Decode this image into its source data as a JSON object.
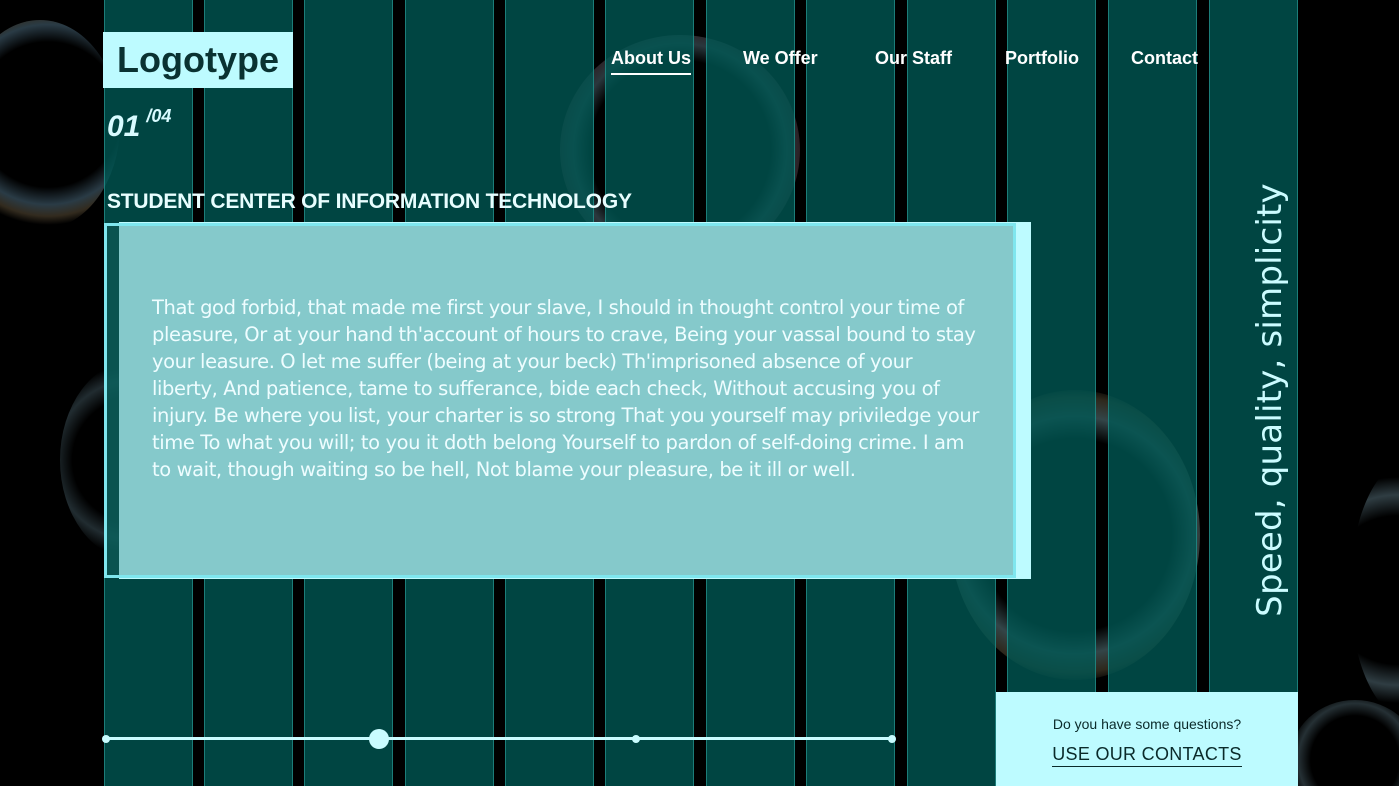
{
  "header": {
    "logo": "Logotype",
    "nav": [
      {
        "label": "About Us",
        "active": true
      },
      {
        "label": "We Offer",
        "active": false
      },
      {
        "label": "Our Staff",
        "active": false
      },
      {
        "label": "Portfolio",
        "active": false
      },
      {
        "label": "Contact",
        "active": false
      }
    ]
  },
  "slide": {
    "current": "01",
    "total": "/04",
    "progress": {
      "current_index": 1,
      "total_slides": 4
    }
  },
  "main": {
    "heading": "STUDENT CENTER OF INFORMATION TECHNOLOGY",
    "body": "That god forbid, that made me first your slave, I should in thought control your time of pleasure, Or at your hand th'account of hours to crave, Being your vassal bound to stay your leasure. O let me suffer (being at your beck) Th'imprisoned absence of your liberty, And patience, tame to sufferance, bide each check, Without accusing you of injury. Be where you list, your charter is so strong That you yourself may priviledge your time To what you will; to you it doth belong Yourself to pardon of self-doing crime. I am to wait, though waiting so be hell, Not blame your pleasure, be it ill or well."
  },
  "tagline": "Speed, quality, simplicity",
  "contact": {
    "question": "Do you have some questions?",
    "link": "USE OUR CONTACTS"
  },
  "colors": {
    "accent": "#bdfbff",
    "column": "#005854",
    "background": "#000000"
  }
}
